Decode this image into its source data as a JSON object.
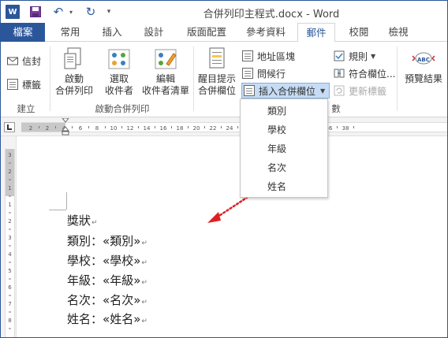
{
  "window": {
    "title": "合併列印主程式.docx - Word",
    "app_icon": "W"
  },
  "quick_access": {
    "save_icon": "save-icon",
    "undo_icon": "undo-icon",
    "redo_icon": "redo-icon"
  },
  "tabs": [
    {
      "label": "檔案"
    },
    {
      "label": "常用"
    },
    {
      "label": "插入"
    },
    {
      "label": "設計"
    },
    {
      "label": "版面配置"
    },
    {
      "label": "參考資料"
    },
    {
      "label": "郵件"
    },
    {
      "label": "校閱"
    },
    {
      "label": "檢視"
    }
  ],
  "ribbon": {
    "create": {
      "envelopes": "信封",
      "labels": "標籤",
      "group_label": "建立"
    },
    "start_merge": {
      "start_line1": "啟動",
      "start_line2": "合併列印",
      "select_line1": "選取",
      "select_line2": "收件者",
      "edit_line1": "編輯",
      "edit_line2": "收件者清單",
      "group_label": "啟動合併列印"
    },
    "write_insert": {
      "highlight_line1": "醒目提示",
      "highlight_line2": "合併欄位",
      "address_block": "地址區塊",
      "greeting_line": "問候行",
      "insert_field": "插入合併欄位",
      "rules": "規則",
      "match_fields": "符合欄位...",
      "update_labels": "更新標籤",
      "group_label_tail": "數"
    },
    "preview": {
      "label": "預覽結果",
      "badge": "ABC"
    }
  },
  "dropdown": {
    "items": [
      "類別",
      "學校",
      "年級",
      "名次",
      "姓名"
    ]
  },
  "document": {
    "heading": "獎狀",
    "lines": [
      {
        "label": "類別：",
        "field": "«類別»"
      },
      {
        "label": "學校：",
        "field": "«學校»"
      },
      {
        "label": "年級：",
        "field": "«年級»"
      },
      {
        "label": "名次：",
        "field": "«名次»"
      },
      {
        "label": "姓名：",
        "field": "«姓名»"
      }
    ],
    "paragraph_mark": "↵"
  },
  "rulers": {
    "horizontal_ticks": [
      "2",
      "2",
      "4",
      "6",
      "8",
      "10",
      "12",
      "14",
      "16",
      "18",
      "20",
      "22",
      "24",
      "26",
      "28",
      "30",
      "32",
      "34",
      "36",
      "38"
    ],
    "vertical_ticks": [
      "3",
      "2",
      "1",
      "1",
      "2",
      "3",
      "4",
      "5",
      "6",
      "7",
      "8"
    ]
  },
  "colors": {
    "accent": "#2b579a",
    "selected_button": "#c5dcf4",
    "annotation_arrow": "#e02020"
  }
}
